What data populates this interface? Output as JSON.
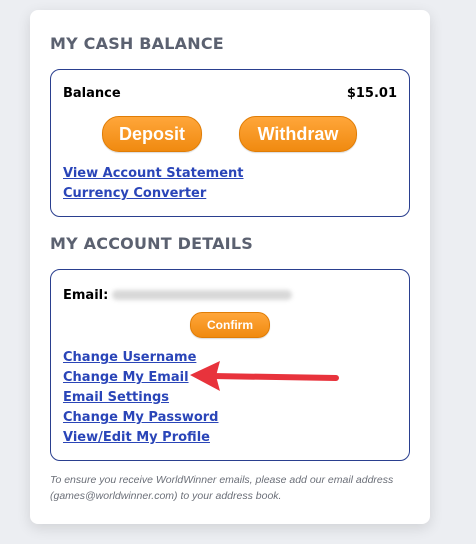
{
  "cash_balance": {
    "title": "MY CASH BALANCE",
    "balance_label": "Balance",
    "balance_value": "$15.01",
    "deposit_label": "Deposit",
    "withdraw_label": "Withdraw",
    "links": [
      "View Account Statement",
      "Currency Converter"
    ]
  },
  "account_details": {
    "title": "MY ACCOUNT DETAILS",
    "email_label": "Email:",
    "confirm_label": "Confirm",
    "links": [
      "Change Username",
      "Change My Email",
      "Email Settings",
      "Change My Password",
      "View/Edit My Profile"
    ]
  },
  "footer_note": "To ensure you receive WorldWinner emails, please add our email address (games@worldwinner.com) to your address book.",
  "colors": {
    "button_orange": "#f5901a",
    "link_blue": "#2a45b8",
    "box_border": "#2a3f8f",
    "arrow_red": "#e8333c"
  },
  "icons": {
    "annotation": "red-arrow-icon"
  }
}
